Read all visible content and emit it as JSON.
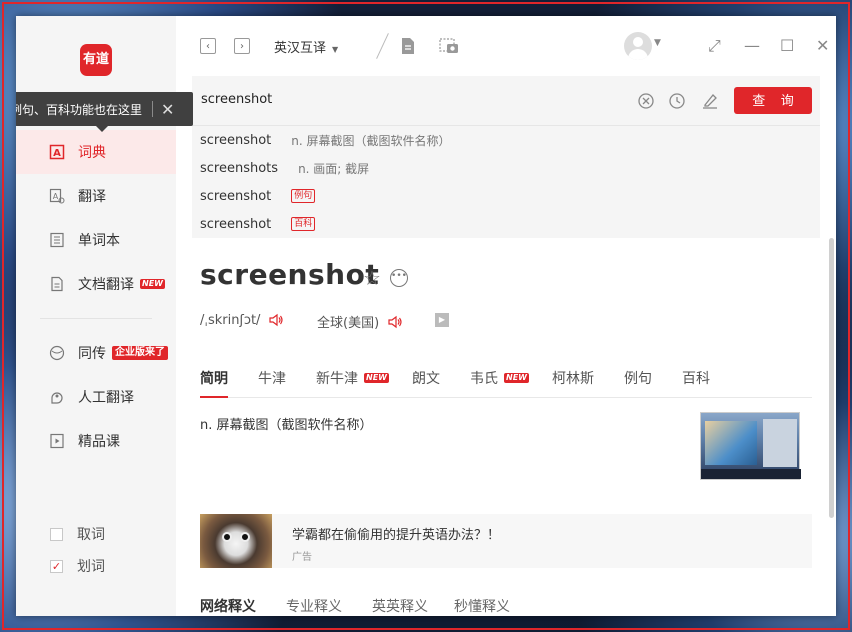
{
  "app": {
    "logo_text": "有道"
  },
  "tooltip": {
    "text": "例句、百科功能也在这里"
  },
  "sidebar": {
    "items": [
      {
        "label": "词典",
        "icon": "dict-icon"
      },
      {
        "label": "翻译",
        "icon": "translate-icon"
      },
      {
        "label": "单词本",
        "icon": "wordbook-icon"
      },
      {
        "label": "文档翻译",
        "icon": "document-icon",
        "badge": "NEW"
      },
      {
        "label": "同传",
        "icon": "simultaneous-icon",
        "badge": "企业版来了"
      },
      {
        "label": "人工翻译",
        "icon": "human-translate-icon"
      },
      {
        "label": "精品课",
        "icon": "course-icon"
      }
    ],
    "checks": [
      {
        "label": "取词",
        "checked": false
      },
      {
        "label": "划词",
        "checked": true
      }
    ]
  },
  "topbar": {
    "lang": "英汉互译"
  },
  "search": {
    "query": "screenshot",
    "button_label": "查 询"
  },
  "suggestions": [
    {
      "word": "screenshot",
      "def": "n. 屏幕截图（截图软件名称）"
    },
    {
      "word": "screenshots",
      "def": "n. 画面; 截屏"
    },
    {
      "word": "screenshot",
      "tag": "例句"
    },
    {
      "word": "screenshot",
      "tag": "百科"
    }
  ],
  "entry": {
    "word": "screenshot",
    "phonetic": "/ˌskrinʃɔt/",
    "region": "全球(美国)",
    "dict_tabs": [
      {
        "label": "简明",
        "active": true
      },
      {
        "label": "牛津"
      },
      {
        "label": "新牛津",
        "badge": "NEW"
      },
      {
        "label": "朗文"
      },
      {
        "label": "韦氏",
        "badge": "NEW"
      },
      {
        "label": "柯林斯"
      },
      {
        "label": "例句"
      },
      {
        "label": "百科"
      }
    ],
    "definition": "n. 屏幕截图（截图软件名称）"
  },
  "ad": {
    "text": "学霸都在偷偷用的提升英语办法？！",
    "label": "广告"
  },
  "sub_tabs": [
    {
      "label": "网络释义",
      "active": true
    },
    {
      "label": "专业释义"
    },
    {
      "label": "英英释义"
    },
    {
      "label": "秒懂释义"
    }
  ],
  "colors": {
    "accent": "#e0262a",
    "sidebar_bg": "#f5f5f5",
    "active_bg": "#fce9e9"
  }
}
